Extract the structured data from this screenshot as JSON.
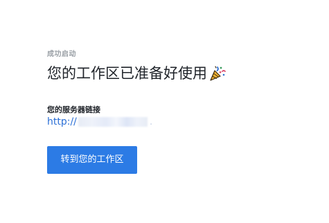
{
  "status_label": "成功启动",
  "headline": "您的工作区已准备好使用",
  "headline_icon": "party-popper-icon",
  "server": {
    "label": "您的服务器链接",
    "link_prefix": "http://"
  },
  "button": {
    "label": "转到您的工作区"
  },
  "colors": {
    "accent": "#2c7be5",
    "link": "#2b6fd6",
    "eyebrow": "#9aa0a6",
    "text": "#1f2329"
  }
}
